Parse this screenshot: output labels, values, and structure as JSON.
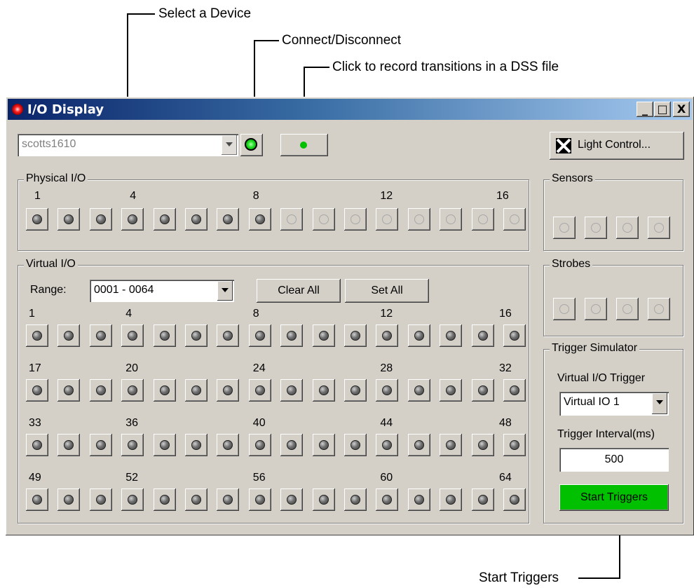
{
  "callouts": {
    "select_device": "Select a Device",
    "connect": "Connect/Disconnect",
    "record": "Click to record transitions in a DSS file",
    "start_triggers": "Start Triggers"
  },
  "window": {
    "title": "I/O Display",
    "minimize": "_",
    "maximize": "□",
    "close": "X"
  },
  "device_select": {
    "value": "scotts1610"
  },
  "light_control": {
    "label": "Light Control..."
  },
  "physical_io": {
    "label": "Physical I/O",
    "numbers": [
      "1",
      "4",
      "8",
      "12",
      "16"
    ],
    "active_count": 8
  },
  "sensors": {
    "label": "Sensors"
  },
  "strobes": {
    "label": "Strobes"
  },
  "virtual_io": {
    "label": "Virtual I/O",
    "range_label": "Range:",
    "range_value": "0001 - 0064",
    "clear_all": "Clear All",
    "set_all": "Set All",
    "rows": [
      [
        "1",
        "4",
        "8",
        "12",
        "16"
      ],
      [
        "17",
        "20",
        "24",
        "28",
        "32"
      ],
      [
        "33",
        "36",
        "40",
        "44",
        "48"
      ],
      [
        "49",
        "52",
        "56",
        "60",
        "64"
      ]
    ]
  },
  "trigger_simulator": {
    "label": "Trigger Simulator",
    "vio_label": "Virtual I/O Trigger",
    "vio_value": "Virtual IO 1",
    "interval_label": "Trigger Interval(ms)",
    "interval_value": "500",
    "start_button": "Start Triggers",
    "start_color": "#00c000"
  }
}
